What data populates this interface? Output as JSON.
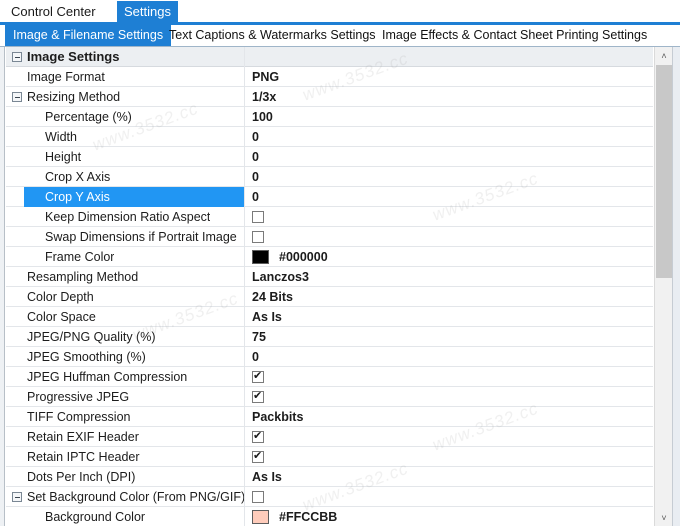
{
  "window": {
    "main_tabs": [
      {
        "label": "Control Center",
        "active": false
      },
      {
        "label": "Settings",
        "active": true
      }
    ],
    "sub_tabs": [
      {
        "label": "Image & Filename Settings",
        "active": true
      },
      {
        "label": "Text Captions & Watermarks Settings",
        "active": false
      },
      {
        "label": "Image Effects & Contact Sheet Printing Settings",
        "active": false
      }
    ]
  },
  "colors": {
    "accent": "#1e7fd4",
    "selection": "#2196f3",
    "group_row": "#eceff2",
    "frame_color_swatch": "#000000",
    "background_color_swatch": "#FFCCBB"
  },
  "scrollbar": {
    "up_arrow": "˄",
    "down_arrow": "˅"
  },
  "watermarks": [
    "www.3532.cc",
    "www.3532.cc",
    "www.3532.cc",
    "www.3532.cc",
    "www.3532.cc",
    "www.3532.cc"
  ],
  "grid": {
    "rows": [
      {
        "label": "Image Settings",
        "level": 0,
        "expander": true,
        "group": true,
        "value_type": "none",
        "value": "",
        "selected": false
      },
      {
        "label": "Image Format",
        "level": 1,
        "expander": false,
        "group": false,
        "value_type": "text",
        "value": "PNG",
        "selected": false
      },
      {
        "label": "Resizing Method",
        "level": 1,
        "expander": true,
        "group": false,
        "value_type": "text",
        "value": "1/3x",
        "selected": false
      },
      {
        "label": "Percentage (%)",
        "level": 2,
        "expander": false,
        "group": false,
        "value_type": "text",
        "value": "100",
        "selected": false
      },
      {
        "label": "Width",
        "level": 2,
        "expander": false,
        "group": false,
        "value_type": "text",
        "value": "0",
        "selected": false
      },
      {
        "label": "Height",
        "level": 2,
        "expander": false,
        "group": false,
        "value_type": "text",
        "value": "0",
        "selected": false
      },
      {
        "label": "Crop X Axis",
        "level": 2,
        "expander": false,
        "group": false,
        "value_type": "text",
        "value": "0",
        "selected": false
      },
      {
        "label": "Crop Y Axis",
        "level": 2,
        "expander": false,
        "group": false,
        "value_type": "text",
        "value": "0",
        "selected": true
      },
      {
        "label": "Keep Dimension Ratio Aspect",
        "level": 2,
        "expander": false,
        "group": false,
        "value_type": "checkbox",
        "value": false,
        "selected": false
      },
      {
        "label": "Swap Dimensions if Portrait Image",
        "level": 2,
        "expander": false,
        "group": false,
        "value_type": "checkbox",
        "value": false,
        "selected": false
      },
      {
        "label": "Frame Color",
        "level": 2,
        "expander": false,
        "group": false,
        "value_type": "color",
        "value": "#000000",
        "selected": false
      },
      {
        "label": "Resampling Method",
        "level": 1,
        "expander": false,
        "group": false,
        "value_type": "text",
        "value": "Lanczos3",
        "selected": false
      },
      {
        "label": "Color Depth",
        "level": 1,
        "expander": false,
        "group": false,
        "value_type": "text",
        "value": "24 Bits",
        "selected": false
      },
      {
        "label": "Color Space",
        "level": 1,
        "expander": false,
        "group": false,
        "value_type": "text",
        "value": "As Is",
        "selected": false
      },
      {
        "label": "JPEG/PNG Quality (%)",
        "level": 1,
        "expander": false,
        "group": false,
        "value_type": "text",
        "value": "75",
        "selected": false
      },
      {
        "label": "JPEG Smoothing (%)",
        "level": 1,
        "expander": false,
        "group": false,
        "value_type": "text",
        "value": "0",
        "selected": false
      },
      {
        "label": "JPEG Huffman Compression",
        "level": 1,
        "expander": false,
        "group": false,
        "value_type": "checkbox",
        "value": true,
        "selected": false
      },
      {
        "label": "Progressive JPEG",
        "level": 1,
        "expander": false,
        "group": false,
        "value_type": "checkbox",
        "value": true,
        "selected": false
      },
      {
        "label": "TIFF Compression",
        "level": 1,
        "expander": false,
        "group": false,
        "value_type": "text",
        "value": "Packbits",
        "selected": false
      },
      {
        "label": "Retain EXIF Header",
        "level": 1,
        "expander": false,
        "group": false,
        "value_type": "checkbox",
        "value": true,
        "selected": false
      },
      {
        "label": "Retain IPTC Header",
        "level": 1,
        "expander": false,
        "group": false,
        "value_type": "checkbox",
        "value": true,
        "selected": false
      },
      {
        "label": "Dots Per Inch (DPI)",
        "level": 1,
        "expander": false,
        "group": false,
        "value_type": "text",
        "value": "As Is",
        "selected": false
      },
      {
        "label": "Set Background Color (From PNG/GIF)",
        "level": 1,
        "expander": true,
        "group": false,
        "value_type": "checkbox",
        "value": false,
        "selected": false
      },
      {
        "label": "Background Color",
        "level": 2,
        "expander": false,
        "group": false,
        "value_type": "color",
        "value": "#FFCCBB",
        "selected": false
      }
    ]
  }
}
